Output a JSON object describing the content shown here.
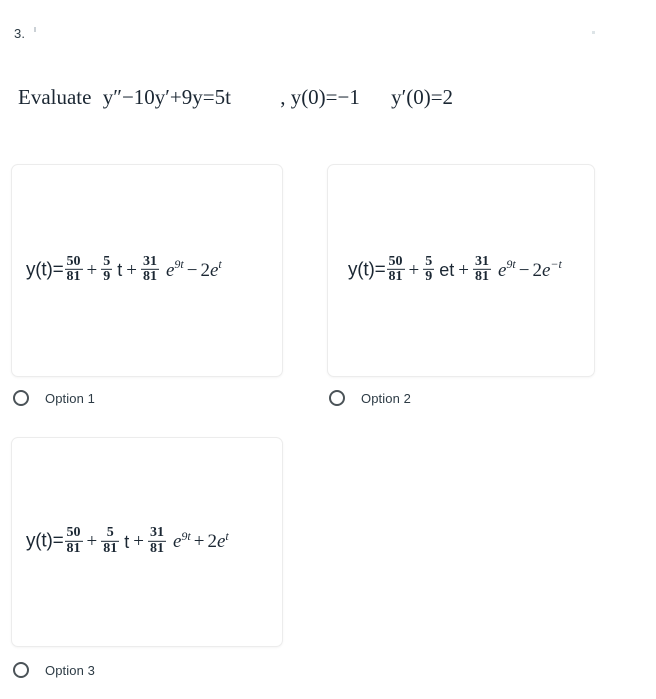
{
  "question": {
    "number": "3.",
    "prompt_prefix": "Evaluate",
    "equation": "y″−10y′+9y=5t",
    "initial_condition_1": ", y(0)=−1",
    "initial_condition_2": "y′(0)=2"
  },
  "options": [
    {
      "id": "option-1",
      "label": "Option 1",
      "selected": false,
      "formula_text": "y(t)=50/81 + 5/9 t + 31/81 e^{9t} − 2e^{t}",
      "parts": {
        "lead": "y(t)=",
        "frac1_num": "50",
        "frac1_den": "81",
        "op1": "+",
        "frac2_num": "5",
        "frac2_den": "9",
        "mid_var": "t",
        "op2": "+",
        "frac3_num": "31",
        "frac3_den": "81",
        "e1_base": "e",
        "e1_exp": "9t",
        "op3": "−",
        "coef": "2",
        "e2_base": "e",
        "e2_exp": "t"
      }
    },
    {
      "id": "option-2",
      "label": "Option 2",
      "selected": false,
      "formula_text": "y(t)=50/81 + 5/9 et + 31/81 e^{9t} − 2e^{−t}",
      "parts": {
        "lead": "y(t)=",
        "frac1_num": "50",
        "frac1_den": "81",
        "op1": "+",
        "frac2_num": "5",
        "frac2_den": "9",
        "mid_var": "et",
        "op2": "+",
        "frac3_num": "31",
        "frac3_den": "81",
        "e1_base": "e",
        "e1_exp": "9t",
        "op3": "−",
        "coef": "2",
        "e2_base": "e",
        "e2_exp": "−t"
      }
    },
    {
      "id": "option-3",
      "label": "Option 3",
      "selected": false,
      "formula_text": "y(t)=50/81 + 5/81 t + 31/81 e^{9t} + 2e^{t}",
      "parts": {
        "lead": "y(t)=",
        "frac1_num": "50",
        "frac1_den": "81",
        "op1": "+",
        "frac2_num": "5",
        "frac2_den": "81",
        "mid_var": "t",
        "op2": "+",
        "frac3_num": "31",
        "frac3_den": "81",
        "e1_base": "e",
        "e1_exp": "9t",
        "op3": "+",
        "coef": "2",
        "e2_base": "e",
        "e2_exp": "t"
      }
    }
  ],
  "colors": {
    "text": "#2d3b45",
    "formula_text": "#1b2733",
    "card_border": "#ececec",
    "radio_border": "#4b5358",
    "background": "#ffffff"
  }
}
